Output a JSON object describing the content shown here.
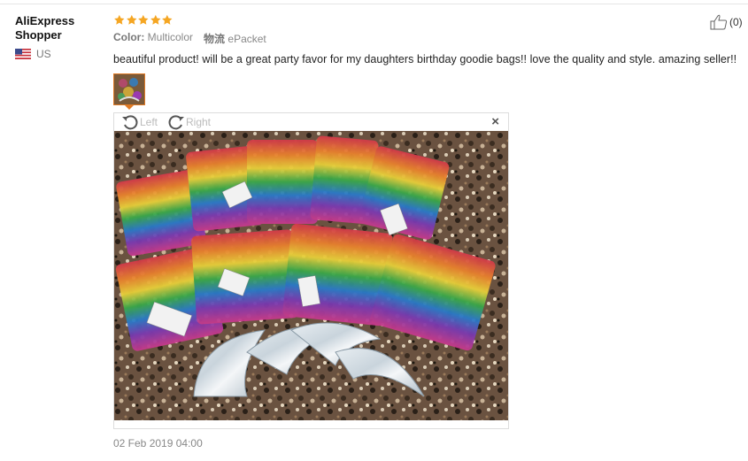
{
  "reviewer": {
    "name": "AliExpress\nShopper",
    "country": "US",
    "flag_icon": "us-flag-icon"
  },
  "review": {
    "rating": 5,
    "max_rating": 5,
    "star_color": "#f5a623",
    "properties": [
      {
        "key": "Color:",
        "value": "Multicolor"
      },
      {
        "key": "物流",
        "value": "ePacket"
      }
    ],
    "text": "beautiful product! will be a great party favor for my daughters birthday goodie bags!! love the quality and style. amazing seller!!",
    "date": "02 Feb 2019 04:00"
  },
  "image_viewer": {
    "rotate_left_label": "Left",
    "rotate_right_label": "Right",
    "close_label": "×",
    "accent_color": "#e07a25"
  },
  "helpful": {
    "count_label": "(0)",
    "icon": "thumbs-up-icon"
  }
}
